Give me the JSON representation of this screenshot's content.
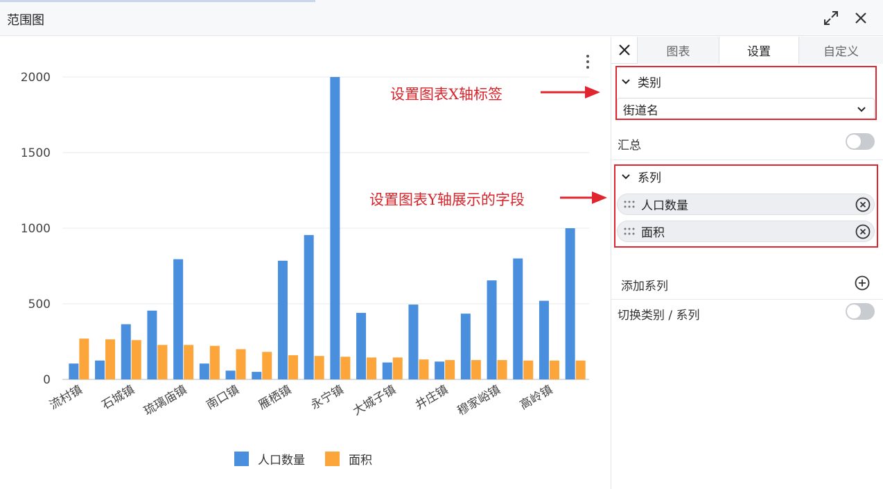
{
  "window": {
    "title": "范围图"
  },
  "panel": {
    "tabs": [
      {
        "label": "图表",
        "active": false
      },
      {
        "label": "设置",
        "active": true
      },
      {
        "label": "自定义",
        "active": false
      }
    ],
    "category": {
      "header": "类别",
      "selected": "街道名"
    },
    "summary": {
      "label": "汇总",
      "enabled": false
    },
    "series": {
      "header": "系列",
      "items": [
        "人口数量",
        "面积"
      ]
    },
    "add_series": {
      "label": "添加系列"
    },
    "switch": {
      "label": "切换类别 / 系列",
      "enabled": false
    }
  },
  "annotations": {
    "x_axis_note": "设置图表X轴标签",
    "y_axis_note": "设置图表Y轴展示的字段",
    "color": "#d8232a"
  },
  "chart_data": {
    "type": "bar",
    "categories": [
      "流村镇",
      "",
      "石城镇",
      "",
      "琉璃庙镇",
      "",
      "南口镇",
      "",
      "雁栖镇",
      "",
      "永宁镇",
      "",
      "大城子镇",
      "",
      "井庄镇",
      "",
      "穆家峪镇",
      "",
      "高岭镇",
      ""
    ],
    "series": [
      {
        "name": "人口数量",
        "color": "#4a8fde",
        "values": [
          105,
          125,
          365,
          455,
          795,
          105,
          58,
          50,
          785,
          955,
          2000,
          440,
          112,
          495,
          118,
          435,
          655,
          800,
          520,
          1000
        ]
      },
      {
        "name": "面积",
        "color": "#fca53a",
        "values": [
          270,
          265,
          260,
          228,
          228,
          222,
          200,
          182,
          160,
          155,
          150,
          145,
          145,
          132,
          128,
          128,
          128,
          125,
          125,
          125
        ]
      }
    ],
    "ylim": [
      0,
      2000
    ],
    "yticks": [
      0,
      500,
      1000,
      1500,
      2000
    ],
    "grid": true,
    "legend": "bottom"
  }
}
